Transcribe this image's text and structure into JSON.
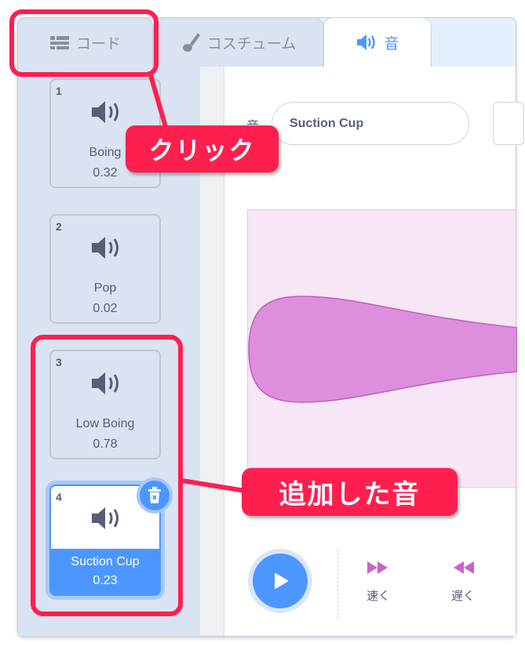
{
  "tabs": [
    {
      "label": "コード",
      "icon": "code-blocks-icon"
    },
    {
      "label": "コスチューム",
      "icon": "brush-icon"
    },
    {
      "label": "音",
      "icon": "speaker-icon",
      "active": true
    }
  ],
  "sounds": [
    {
      "number": "1",
      "name": "Boing",
      "duration": "0.32"
    },
    {
      "number": "2",
      "name": "Pop",
      "duration": "0.02"
    },
    {
      "number": "3",
      "name": "Low Boing",
      "duration": "0.78"
    },
    {
      "number": "4",
      "name": "Suction Cup",
      "duration": "0.23",
      "selected": true
    }
  ],
  "editor": {
    "name_label": "音",
    "name_value": "Suction Cup",
    "wave_color": "#dd8edd",
    "wave_bg": "#f7e6f6"
  },
  "controls": {
    "faster_label": "速く",
    "slower_label": "遅く",
    "accent": "#4c97ff",
    "effect_color": "#c863c8"
  },
  "annotations": {
    "click_label": "クリック",
    "added_label": "追加した音",
    "color": "#ff1f4f"
  }
}
